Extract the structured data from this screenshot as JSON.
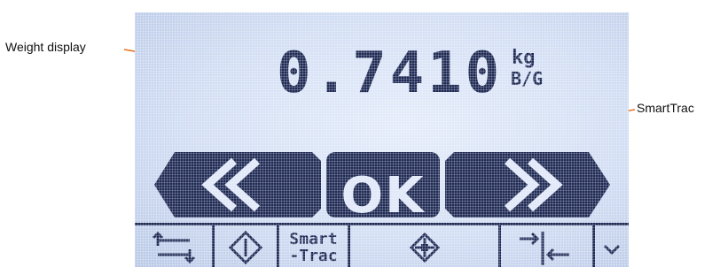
{
  "callouts": {
    "weight_display": "Weight display",
    "smarttrac": "SmartTrac"
  },
  "display": {
    "weight_value": "0.7410",
    "unit": "kg",
    "mode": "B/G"
  },
  "smarttrac_bar": {
    "left_symbol": "<<",
    "center_label": "OK",
    "right_symbol": ">>"
  },
  "softkeys": [
    {
      "icon": "swap-arrows-icon"
    },
    {
      "icon": "tare-diamond-icon"
    },
    {
      "line1": "Smart",
      "line2": "-Trac"
    },
    {
      "icon": "target-diamond-icon"
    },
    {
      "icon": "zero-arrows-icon"
    },
    {
      "icon": "chevron-down-icon"
    }
  ],
  "colors": {
    "lcd_background": "#d2def4",
    "lcd_ink": "#1f2a54",
    "callout_line": "#e8701a"
  }
}
